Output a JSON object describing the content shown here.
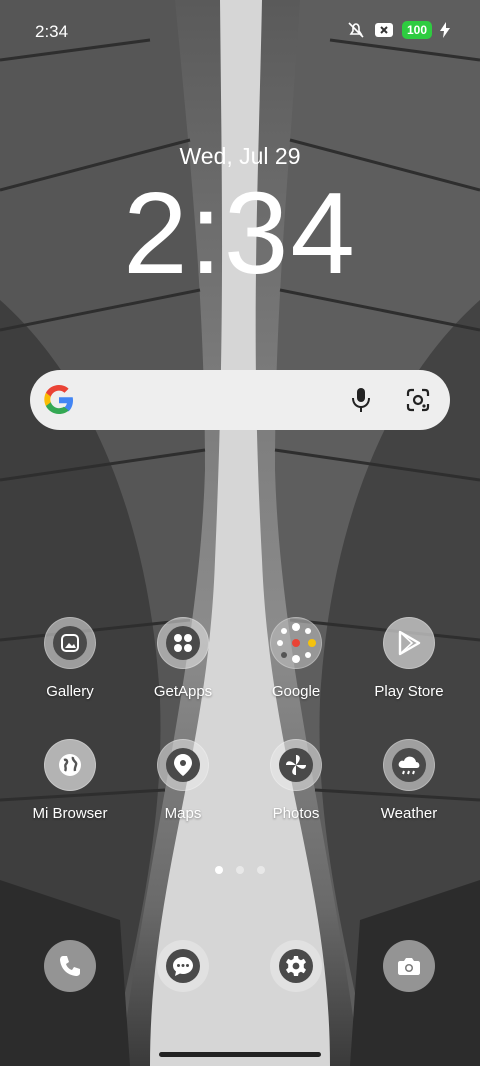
{
  "status": {
    "time": "2:34",
    "battery": "100"
  },
  "lockclock": {
    "date": "Wed, Jul 29",
    "time": "2:34"
  },
  "apps_row1": [
    {
      "label": "Gallery",
      "icon": "gallery-icon"
    },
    {
      "label": "GetApps",
      "icon": "getapps-icon"
    },
    {
      "label": "Google",
      "icon": "google-folder-icon"
    },
    {
      "label": "Play Store",
      "icon": "play-store-icon"
    }
  ],
  "apps_row2": [
    {
      "label": "Mi Browser",
      "icon": "globe-icon"
    },
    {
      "label": "Maps",
      "icon": "map-pin-icon"
    },
    {
      "label": "Photos",
      "icon": "pinwheel-icon"
    },
    {
      "label": "Weather",
      "icon": "cloud-rain-icon"
    }
  ],
  "dock": [
    {
      "icon": "phone-icon"
    },
    {
      "icon": "message-icon"
    },
    {
      "icon": "settings-gear-icon"
    },
    {
      "icon": "camera-icon"
    }
  ],
  "page_indicator": {
    "count": 3,
    "active": 1
  }
}
